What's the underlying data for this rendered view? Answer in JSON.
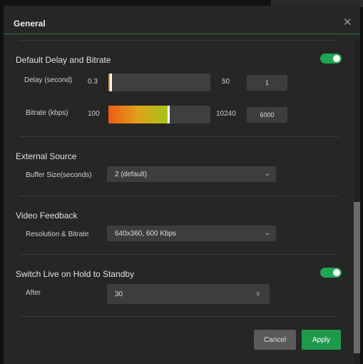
{
  "dialog": {
    "title": "General",
    "close_icon": "close-icon"
  },
  "delay_bitrate": {
    "title": "Default Delay and Bitrate",
    "enabled": true,
    "delay": {
      "label": "Delay (second)",
      "min": "0.3",
      "max": "50",
      "value": "1",
      "fraction": 0.014
    },
    "bitrate": {
      "label": "Bitrate (kbps)",
      "min": "100",
      "max": "10240",
      "value": "6000",
      "fraction": 0.58
    }
  },
  "external_source": {
    "title": "External Source",
    "buffer_label": "Buffer Size(seconds)",
    "buffer_value": "2 (default)"
  },
  "video_feedback": {
    "title": "Video Feedback",
    "resolution_label": "Resolution & Bitrate",
    "resolution_value": "640x360, 600 Kbps"
  },
  "switch_live": {
    "title": "Switch Live on Hold to Standby",
    "enabled": true,
    "after_label": "After",
    "after_value": "30",
    "unit": "s"
  },
  "buttons": {
    "cancel": "Cancel",
    "apply": "Apply"
  },
  "colors": {
    "accent": "#1fa653",
    "apply": "#1f9a4c"
  }
}
